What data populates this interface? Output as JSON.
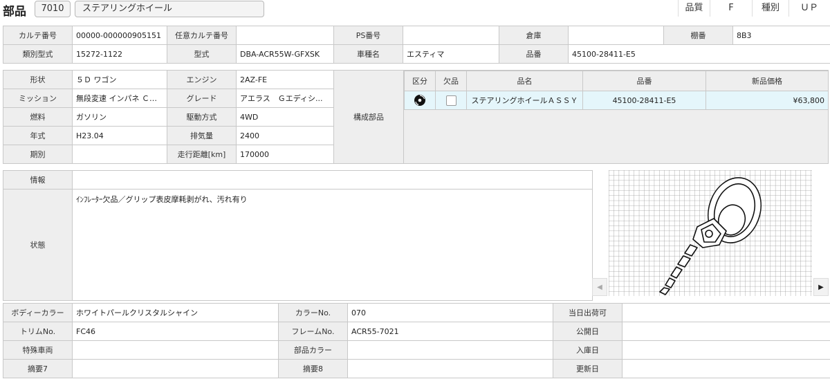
{
  "header": {
    "title": "部品",
    "code": "7010",
    "name": "ステアリングホイール",
    "quality_label": "品質",
    "quality_value": "F",
    "type_label": "種別",
    "type_value": "ＵＰ"
  },
  "row1": {
    "karte_label": "カルテ番号",
    "karte_value": "00000-000000905151",
    "any_karte_label": "任意カルテ番号",
    "any_karte_value": "",
    "ps_label": "PS番号",
    "ps_value": "",
    "warehouse_label": "倉庫",
    "warehouse_value": "",
    "shelf_label": "棚番",
    "shelf_value": "8B3"
  },
  "row2": {
    "class_label": "類別型式",
    "class_value": "15272-1122",
    "model_label": "型式",
    "model_value": "DBA-ACR55W-GFXSK",
    "car_label": "車種名",
    "car_value": "エスティマ",
    "partno_label": "品番",
    "partno_value": "45100-28411-E5"
  },
  "spec": {
    "shape_label": "形状",
    "shape_value": "５Ｄ ワゴン",
    "engine_label": "エンジン",
    "engine_value": "2AZ-FE",
    "mission_label": "ミッション",
    "mission_value": "無段変速 インパネ ＣＶＴ",
    "grade_label": "グレード",
    "grade_value": "アエラス　Ｇエディシ...",
    "fuel_label": "燃料",
    "fuel_value": "ガソリン",
    "drive_label": "駆動方式",
    "drive_value": "4WD",
    "year_label": "年式",
    "year_value": "H23.04",
    "displacement_label": "排気量",
    "displacement_value": "2400",
    "period_label": "期別",
    "period_value": "",
    "mileage_label": "走行距離[km]",
    "mileage_value": "170000",
    "components_label": "構成部品"
  },
  "parts_table": {
    "headers": [
      "区分",
      "欠品",
      "品名",
      "品番",
      "新品価格"
    ],
    "rows": [
      {
        "name": "ステアリングホイールＡＳＳＹ",
        "number": "45100-28411-E5",
        "price": "¥63,800"
      }
    ]
  },
  "info": {
    "info_label": "情報",
    "info_value": "",
    "state_label": "状態",
    "state_value": "ｲﾝﾌﾚｰﾀｰ欠品／グリップ表皮摩耗剥がれ、汚れ有り"
  },
  "bottom": {
    "body_color_label": "ボディーカラー",
    "body_color_value": "ホワイトパールクリスタルシャイン",
    "color_no_label": "カラーNo.",
    "color_no_value": "070",
    "today_ship_label": "当日出荷可",
    "today_ship_value": "",
    "trim_label": "トリムNo.",
    "trim_value": "FC46",
    "frame_label": "フレームNo.",
    "frame_value": "ACR55-7021",
    "public_label": "公開日",
    "public_value": "",
    "special_label": "特殊車両",
    "special_value": "",
    "part_color_label": "部品カラー",
    "part_color_value": "",
    "arrival_label": "入庫日",
    "arrival_value": "",
    "note7_label": "摘要7",
    "note7_value": "",
    "note8_label": "摘要8",
    "note8_value": "",
    "updated_label": "更新日",
    "updated_value": ""
  },
  "icons": {
    "disc": "disc-icon",
    "checkbox": "checkbox-icon",
    "prev": "chevron-left-icon",
    "next": "chevron-right-icon"
  }
}
